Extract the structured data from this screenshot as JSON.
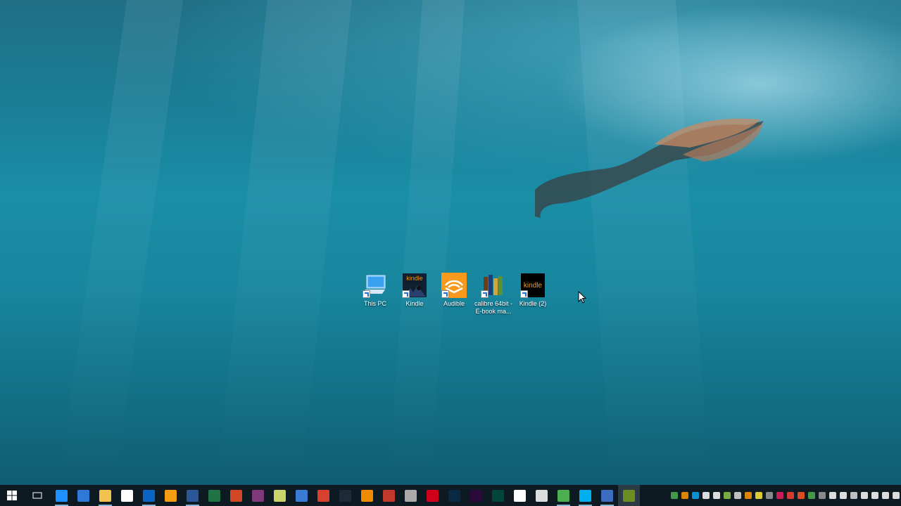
{
  "desktop": {
    "icons": [
      {
        "label": "This PC",
        "icon": "computer-icon"
      },
      {
        "label": "Kindle",
        "icon": "kindle-icon",
        "text": "kindle"
      },
      {
        "label": "Audible",
        "icon": "audible-icon"
      },
      {
        "label": "calibre 64bit - E-book ma...",
        "icon": "calibre-icon"
      },
      {
        "label": "Kindle (2)",
        "icon": "kindle-icon",
        "text": "kindle"
      }
    ]
  },
  "taskbar": {
    "apps": [
      {
        "name": "task-view",
        "color": "#0e1a22"
      },
      {
        "name": "internet-explorer",
        "color": "#1e90ff",
        "glyph": "e"
      },
      {
        "name": "edge",
        "color": "#2f7ad8",
        "glyph": "e"
      },
      {
        "name": "file-explorer",
        "color": "#f2c14e"
      },
      {
        "name": "store",
        "color": "#ffffff"
      },
      {
        "name": "outlook",
        "color": "#0a64c2",
        "glyph": "O"
      },
      {
        "name": "app-orange",
        "color": "#f39c12"
      },
      {
        "name": "word",
        "color": "#2b579a",
        "glyph": "W"
      },
      {
        "name": "excel",
        "color": "#217346",
        "glyph": "X"
      },
      {
        "name": "powerpoint",
        "color": "#d24726",
        "glyph": "P"
      },
      {
        "name": "onenote",
        "color": "#80397b",
        "glyph": "N"
      },
      {
        "name": "notes",
        "color": "#c9d36a"
      },
      {
        "name": "globe-app",
        "color": "#3a7bd5"
      },
      {
        "name": "app-red",
        "color": "#d8402f"
      },
      {
        "name": "lightroom",
        "color": "#1d2a38",
        "glyph": "Lr"
      },
      {
        "name": "vlc",
        "color": "#f08a00"
      },
      {
        "name": "foxit",
        "color": "#c0392b",
        "glyph": "R"
      },
      {
        "name": "satellite",
        "color": "#aaaaaa"
      },
      {
        "name": "acrobat",
        "color": "#d0021b"
      },
      {
        "name": "photoshop",
        "color": "#0a2a44",
        "glyph": "Ps"
      },
      {
        "name": "premiere",
        "color": "#2a0a3a",
        "glyph": "Pr"
      },
      {
        "name": "audition",
        "color": "#00473a",
        "glyph": "Au"
      },
      {
        "name": "calculator",
        "color": "#ffffff"
      },
      {
        "name": "paint",
        "color": "#dddddd"
      },
      {
        "name": "chrome",
        "color": "#4caf50"
      },
      {
        "name": "skype",
        "color": "#00aff0",
        "glyph": "S"
      },
      {
        "name": "app-blue",
        "color": "#3c6dbf"
      },
      {
        "name": "calibre",
        "color": "#6b8e23"
      }
    ]
  }
}
